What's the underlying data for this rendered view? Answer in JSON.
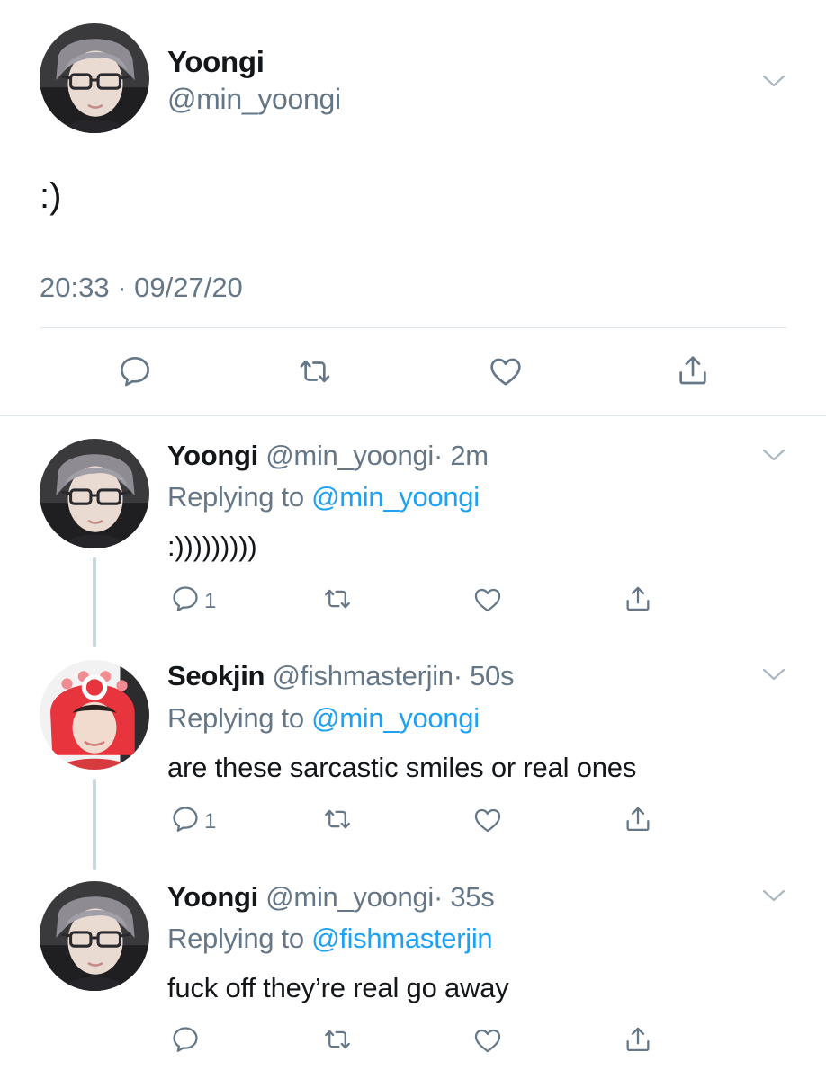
{
  "main_tweet": {
    "name": "Yoongi",
    "handle": "@min_yoongi",
    "text": ":)",
    "timestamp": "20:33 · 09/27/20",
    "avatar": "yoongi-avatar"
  },
  "replies": [
    {
      "name": "Yoongi",
      "handle": "@min_yoongi",
      "time": "· 2m",
      "replying_prefix": "Replying to ",
      "replying_to": "@min_yoongi",
      "text": ":)))))))))",
      "reply_count": "1",
      "avatar": "yoongi-avatar"
    },
    {
      "name": "Seokjin",
      "handle": "@fishmasterjin",
      "time": "· 50s",
      "replying_prefix": "Replying to ",
      "replying_to": "@min_yoongi",
      "text": "are these sarcastic smiles or real ones",
      "reply_count": "1",
      "avatar": "seokjin-avatar"
    },
    {
      "name": "Yoongi",
      "handle": "@min_yoongi",
      "time": "· 35s",
      "replying_prefix": "Replying to ",
      "replying_to": "@fishmasterjin",
      "text": "fuck off they’re real go away",
      "reply_count": "",
      "avatar": "yoongi-avatar"
    }
  ],
  "icons": {
    "reply": "reply-icon",
    "retweet": "retweet-icon",
    "like": "heart-icon",
    "share": "share-icon",
    "menu": "chevron-down-icon"
  },
  "colors": {
    "text": "#14171a",
    "secondary": "#657786",
    "mention": "#1da1f2",
    "divider": "#e1e8ed",
    "thread_line": "#ccd6dd"
  }
}
